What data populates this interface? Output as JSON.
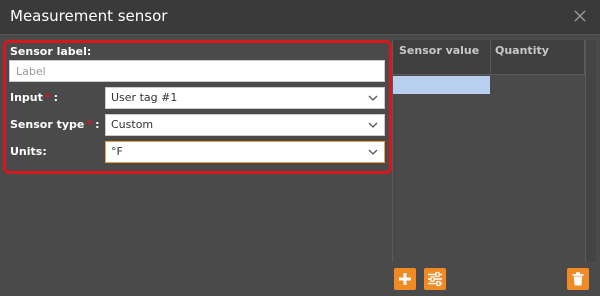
{
  "dialog": {
    "title": "Measurement sensor",
    "close_icon": "close-icon"
  },
  "form": {
    "sensor_label": {
      "label": "Sensor label:",
      "value": "",
      "placeholder": "Label"
    },
    "input": {
      "label": "Input",
      "required_mark": "*",
      "colon": ":",
      "value": "User tag #1"
    },
    "sensor_type": {
      "label": "Sensor type",
      "required_mark": "*",
      "colon": ":",
      "value": "Custom"
    },
    "units": {
      "label": "Units:",
      "value": "°F"
    }
  },
  "table": {
    "columns": [
      "Sensor value",
      "Quantity"
    ]
  },
  "toolbar": {
    "add_icon": "plus-icon",
    "settings_icon": "sliders-icon",
    "delete_icon": "trash-icon"
  },
  "colors": {
    "accent": "#f08a24",
    "highlight_border": "#d6181e",
    "selected_row": "#b8cfef"
  }
}
